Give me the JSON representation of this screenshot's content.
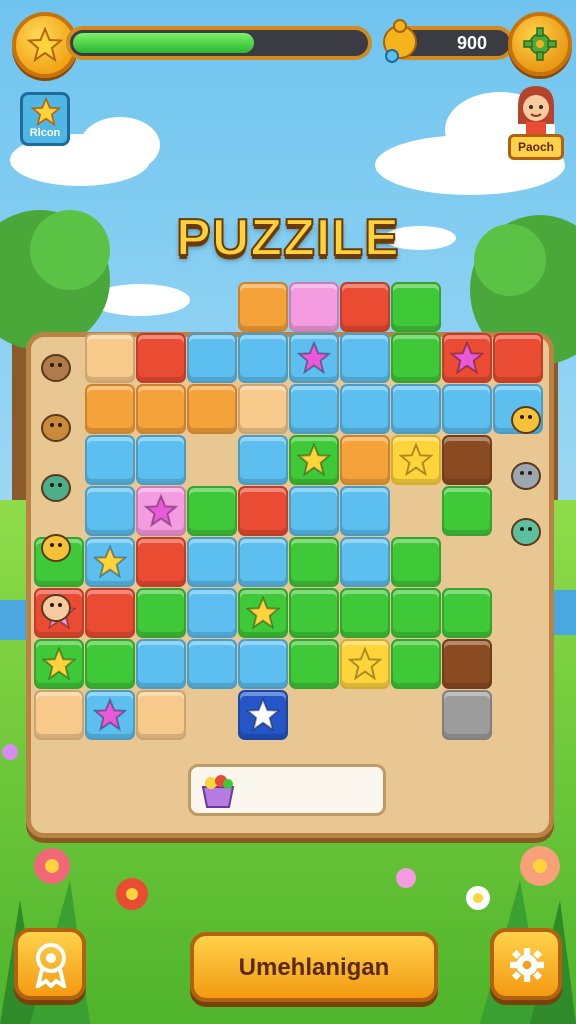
{
  "header": {
    "level_progress": 0.62,
    "score": "900",
    "left_badge_label": "Rlcon",
    "right_badge_label": "Paoch",
    "star_icon": "star-icon",
    "settings_icon": "gear-icon"
  },
  "title": "PUZZILE",
  "board": {
    "legend_colors": {
      "O": "#f6a23a",
      "P": "#f59be0",
      "R": "#ea4b33",
      "G": "#3fc838",
      "B": "#5cbff0",
      "T": "#f7c98a",
      "Y": "#ffd43b",
      "N": "#8a4b22",
      "D": "#2456c8",
      "S": "#9c9c9c"
    },
    "grid": [
      "....OPRG..",
      ".TRBBBBGRR",
      ".OOOTBBBBB",
      ".BB.BGOYN.",
      ".BPGRBB.G.",
      "GBRBBGBG..",
      "RRGBGGGGG.",
      "GGBBBGYGN.",
      "TBT.D...S."
    ],
    "stars": [
      {
        "r": 1,
        "c": 5,
        "color": "#e85ad8"
      },
      {
        "r": 1,
        "c": 8,
        "color": "#e85ad8"
      },
      {
        "r": 3,
        "c": 5,
        "color": "#ffd43b"
      },
      {
        "r": 3,
        "c": 7,
        "color": "#ffd43b"
      },
      {
        "r": 4,
        "c": 2,
        "color": "#e85ad8"
      },
      {
        "r": 5,
        "c": 1,
        "color": "#ffd43b"
      },
      {
        "r": 6,
        "c": 0,
        "color": "#f59be0"
      },
      {
        "r": 6,
        "c": 4,
        "color": "#ffd43b"
      },
      {
        "r": 7,
        "c": 0,
        "color": "#ffd43b"
      },
      {
        "r": 7,
        "c": 6,
        "color": "#ffd43b"
      },
      {
        "r": 8,
        "c": 1,
        "color": "#e85ad8"
      },
      {
        "r": 8,
        "c": 4,
        "color": "#ffffff"
      }
    ],
    "left_pieces": [
      "character-icon",
      "bucket-icon",
      "leaf-icon",
      "cheese-icon",
      "character-icon"
    ],
    "right_pieces": [
      "figure-icon",
      "bucket-icon",
      "fish-icon"
    ]
  },
  "bottom": {
    "main_button_label": "Umehlanigan",
    "left_icon": "award-icon",
    "right_icon": "gear-icon"
  }
}
